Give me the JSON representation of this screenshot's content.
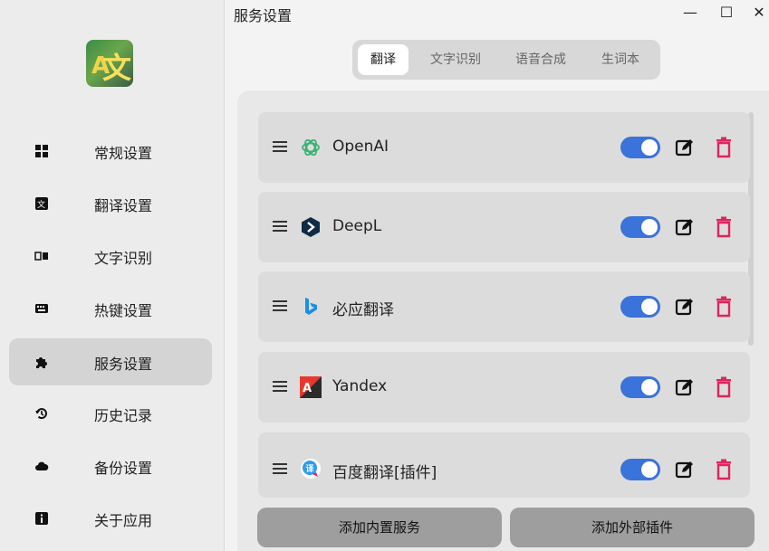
{
  "window": {
    "title": "服务设置",
    "minimize": "—",
    "maximize": "☐",
    "close": "✕"
  },
  "sidebar": {
    "items": [
      {
        "label": "常规设置",
        "icon": "grid-icon"
      },
      {
        "label": "翻译设置",
        "icon": "translate-icon"
      },
      {
        "label": "文字识别",
        "icon": "ocr-icon"
      },
      {
        "label": "热键设置",
        "icon": "keyboard-icon"
      },
      {
        "label": "服务设置",
        "icon": "puzzle-icon",
        "active": true
      },
      {
        "label": "历史记录",
        "icon": "history-icon"
      },
      {
        "label": "备份设置",
        "icon": "cloud-icon"
      },
      {
        "label": "关于应用",
        "icon": "info-icon"
      }
    ]
  },
  "tabs": [
    {
      "label": "翻译",
      "active": true
    },
    {
      "label": "文字识别"
    },
    {
      "label": "语音合成"
    },
    {
      "label": "生词本"
    }
  ],
  "services": [
    {
      "name": "OpenAI",
      "icon": "openai-icon",
      "enabled": true
    },
    {
      "name": "DeepL",
      "icon": "deepl-icon",
      "enabled": true
    },
    {
      "name": "必应翻译",
      "icon": "bing-icon",
      "enabled": true
    },
    {
      "name": "Yandex",
      "icon": "yandex-icon",
      "enabled": true
    },
    {
      "name": "百度翻译[插件]",
      "icon": "baidu-icon",
      "enabled": true
    }
  ],
  "actions": {
    "add_builtin": "添加内置服务",
    "add_external": "添加外部插件"
  },
  "colors": {
    "toggle_on": "#3a73d9",
    "delete": "#e0245e",
    "openai_green": "#3bb273",
    "bing_blue": "#1b8fe0"
  }
}
